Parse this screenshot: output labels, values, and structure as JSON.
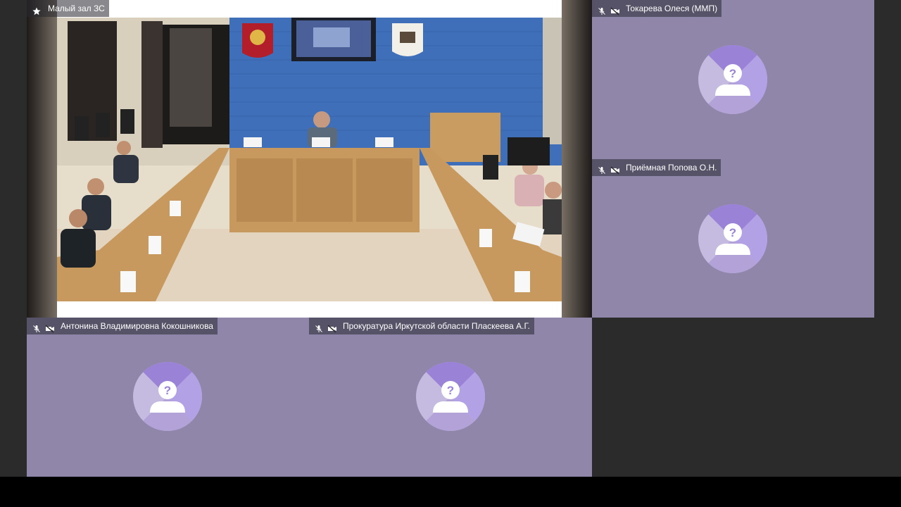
{
  "main_video": {
    "title": "Малый зал ЗС"
  },
  "participants": [
    {
      "name": "Токарева Олеся (ММП)"
    },
    {
      "name": "Приёмная Попова О.Н."
    },
    {
      "name": "Антонина Владимировна Кокошникова"
    },
    {
      "name": "Прокуратура Иркутской области Пласкеева А.Г."
    }
  ],
  "icons": {
    "pin": "star-icon",
    "mic_off": "mic-off-icon",
    "cam_off": "camera-off-icon",
    "avatar": "unknown-user-avatar"
  },
  "colors": {
    "tile_bg": "#8f86aa",
    "avatar_dark": "#9a82d6",
    "avatar_light": "#c5badf",
    "page_bg": "#2b2b2b"
  }
}
